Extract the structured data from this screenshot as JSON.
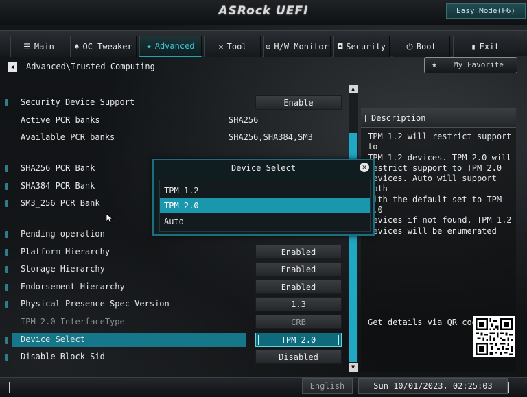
{
  "header": {
    "logo": "ASRock UEFI",
    "easy_mode_label": "Easy Mode(F6)"
  },
  "tabs": [
    {
      "label": "Main",
      "icon": "list-icon",
      "active": false
    },
    {
      "label": "OC Tweaker",
      "icon": "flame-icon",
      "active": false
    },
    {
      "label": "Advanced",
      "icon": "star-icon",
      "active": true
    },
    {
      "label": "Tool",
      "icon": "wrench-icon",
      "active": false
    },
    {
      "label": "H/W Monitor",
      "icon": "globe-icon",
      "active": false
    },
    {
      "label": "Security",
      "icon": "shield-icon",
      "active": false
    },
    {
      "label": "Boot",
      "icon": "power-icon",
      "active": false
    },
    {
      "label": "Exit",
      "icon": "exit-icon",
      "active": false
    }
  ],
  "breadcrumb": "Advanced\\Trusted Computing",
  "favorite_label": "My Favorite",
  "settings": {
    "security_device_support": {
      "label": "Security Device Support",
      "value": "Enable"
    },
    "active_pcr_banks": {
      "label": "Active PCR banks",
      "value": "SHA256"
    },
    "available_pcr_banks": {
      "label": "Available PCR banks",
      "value": "SHA256,SHA384,SM3"
    },
    "sha256_pcr_bank": {
      "label": "SHA256 PCR Bank"
    },
    "sha384_pcr_bank": {
      "label": "SHA384 PCR Bank"
    },
    "sm3_256_pcr_bank": {
      "label": "SM3_256 PCR Bank"
    },
    "pending_operation": {
      "label": "Pending operation"
    },
    "platform_hierarchy": {
      "label": "Platform Hierarchy",
      "value": "Enabled"
    },
    "storage_hierarchy": {
      "label": "Storage Hierarchy",
      "value": "Enabled"
    },
    "endorsement_hierarchy": {
      "label": "Endorsement Hierarchy",
      "value": "Enabled"
    },
    "physical_presence_spec": {
      "label": "Physical Presence Spec Version",
      "value": "1.3"
    },
    "tpm20_interface_type": {
      "label": "TPM 2.0 InterfaceType",
      "value": "CRB"
    },
    "device_select": {
      "label": "Device Select",
      "value": "TPM 2.0"
    },
    "disable_block_sid": {
      "label": "Disable Block Sid",
      "value": "Disabled"
    }
  },
  "description": {
    "title": "Description",
    "lines": [
      "TPM 1.2 will restrict support to",
      "TPM 1.2 devices. TPM 2.0 will",
      "restrict support to TPM 2.0",
      "devices. Auto will support both",
      "with the default set to TPM 2.0",
      "devices if not found. TPM 1.2",
      "devices will be enumerated"
    ],
    "qr_label": "Get details via QR code"
  },
  "modal": {
    "title": "Device Select",
    "options": [
      "TPM 1.2",
      "TPM 2.0",
      "Auto"
    ],
    "selected": "TPM 2.0"
  },
  "footer": {
    "language": "English",
    "datetime": "Sun 10/01/2023, 02:25:03"
  },
  "colors": {
    "accent": "#1fa7c4",
    "highlight_row": "#16778a",
    "active_tab_text": "#3ec1d3"
  }
}
